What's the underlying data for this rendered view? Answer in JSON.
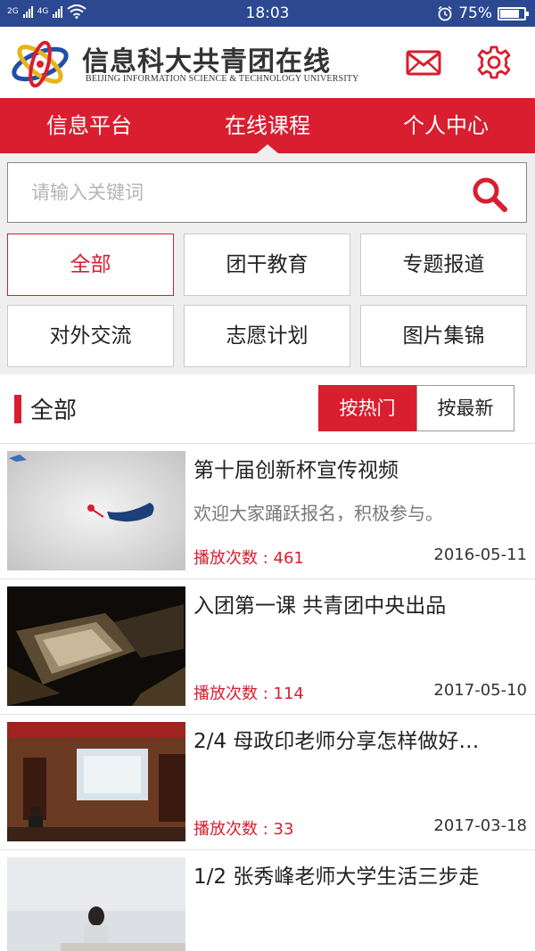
{
  "status_bar": {
    "network_1": "2G",
    "network_2": "4G",
    "network_3": "2G",
    "time": "18:03",
    "battery": "75%",
    "battery_level": 0.75
  },
  "header": {
    "title": "信息科大共青团在线",
    "subtitle": "Beijing Information Science & Technology University",
    "mail_icon": "mail-icon",
    "settings_icon": "gear-icon"
  },
  "nav": {
    "tabs": [
      {
        "label": "信息平台",
        "active": false
      },
      {
        "label": "在线课程",
        "active": true
      },
      {
        "label": "个人中心",
        "active": false
      }
    ]
  },
  "search": {
    "placeholder": "请输入关键词",
    "value": "",
    "icon": "search-icon"
  },
  "categories": [
    {
      "label": "全部",
      "active": true
    },
    {
      "label": "团干教育",
      "active": false
    },
    {
      "label": "专题报道",
      "active": false
    },
    {
      "label": "对外交流",
      "active": false
    },
    {
      "label": "志愿计划",
      "active": false
    },
    {
      "label": "图片集锦",
      "active": false
    }
  ],
  "section": {
    "title": "全部",
    "sort_hot": "按热门",
    "sort_new": "按最新",
    "sort_active": "hot"
  },
  "videos": [
    {
      "title": "第十届创新杯宣传视频",
      "desc": "欢迎大家踊跃报名，积极参与。",
      "plays": "播放次数 : 461",
      "date": "2016-05-11"
    },
    {
      "title": "入团第一课 共青团中央出品",
      "desc": "",
      "plays": "播放次数 : 114",
      "date": "2017-05-10"
    },
    {
      "title": "2/4 母政印老师分享怎样做好…",
      "desc": "",
      "plays": "播放次数 : 33",
      "date": "2017-03-18"
    },
    {
      "title": "1/2 张秀峰老师大学生活三步走",
      "desc": "",
      "plays": "",
      "date": ""
    }
  ],
  "colors": {
    "status_bar": "#2c4891",
    "brand_red": "#d81e2f",
    "background_gray": "#efefef"
  }
}
